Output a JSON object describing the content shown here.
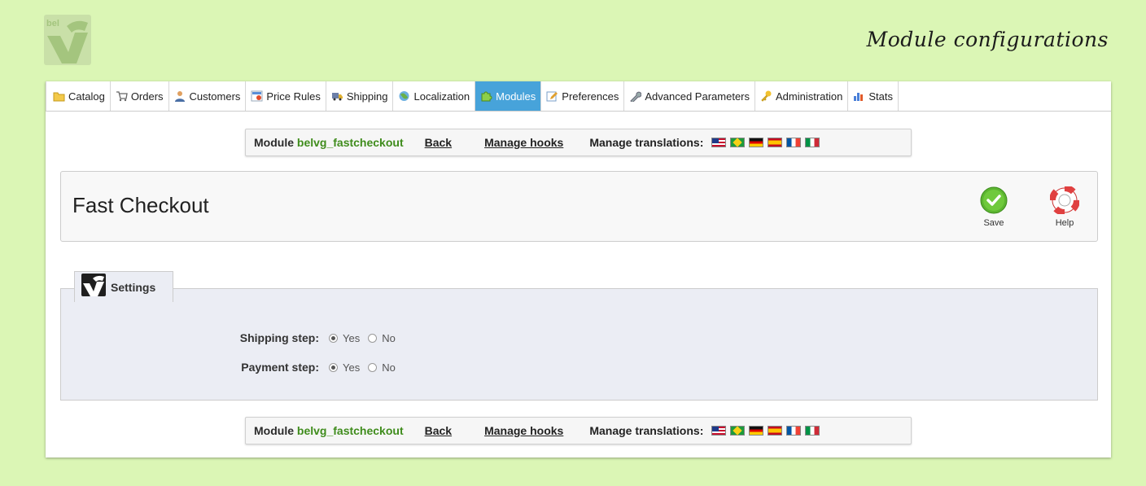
{
  "page_heading": "Module configurations",
  "tabs": [
    {
      "label": "Catalog",
      "icon": "folder-icon"
    },
    {
      "label": "Orders",
      "icon": "cart-icon"
    },
    {
      "label": "Customers",
      "icon": "user-icon"
    },
    {
      "label": "Price Rules",
      "icon": "price-tag-icon"
    },
    {
      "label": "Shipping",
      "icon": "truck-icon"
    },
    {
      "label": "Localization",
      "icon": "globe-icon"
    },
    {
      "label": "Modules",
      "icon": "puzzle-icon",
      "active": true
    },
    {
      "label": "Preferences",
      "icon": "pencil-icon"
    },
    {
      "label": "Advanced Parameters",
      "icon": "wrench-icon"
    },
    {
      "label": "Administration",
      "icon": "key-icon"
    },
    {
      "label": "Stats",
      "icon": "bar-chart-icon"
    }
  ],
  "toolbar": {
    "module_prefix": "Module",
    "module_name": "belvg_fastcheckout",
    "back": "Back",
    "manage_hooks": "Manage hooks",
    "manage_translations": "Manage translations:",
    "flags": [
      "flag-us-icon",
      "flag-br-icon",
      "flag-de-icon",
      "flag-es-icon",
      "flag-fr-icon",
      "flag-it-icon"
    ]
  },
  "module_title": "Fast Checkout",
  "actions": {
    "save": "Save",
    "help": "Help"
  },
  "settings": {
    "legend": "Settings",
    "rows": [
      {
        "label": "Shipping step:",
        "yes": "Yes",
        "no": "No",
        "selected": "Yes"
      },
      {
        "label": "Payment step:",
        "yes": "Yes",
        "no": "No",
        "selected": "Yes"
      }
    ]
  },
  "colors": {
    "background": "#dbf6b5",
    "active_tab": "#47a3da",
    "module_name": "#3f8c1c",
    "fieldset": "#ebedf4"
  }
}
